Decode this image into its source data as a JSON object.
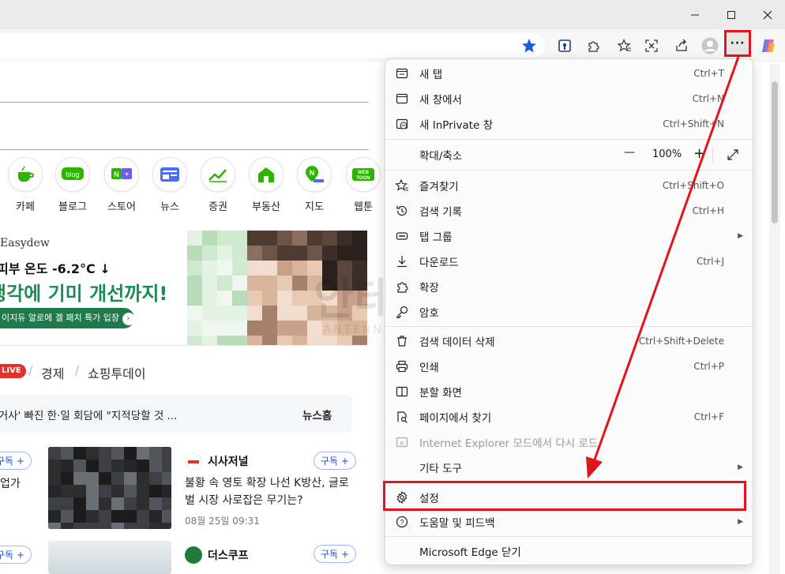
{
  "window": {
    "minimize": "—",
    "maximize": "☐",
    "close": "✕"
  },
  "shortcuts": [
    {
      "label": "카페",
      "icon": "cafe-icon",
      "color": "#2db400"
    },
    {
      "label": "블로그",
      "icon": "blog-icon",
      "color": "#2db400"
    },
    {
      "label": "스토어",
      "icon": "store-icon",
      "color": "#2db400"
    },
    {
      "label": "뉴스",
      "icon": "news-icon",
      "color": "#4a6cf7"
    },
    {
      "label": "증권",
      "icon": "stock-icon",
      "color": "#2db400"
    },
    {
      "label": "부동산",
      "icon": "realestate-icon",
      "color": "#2db400"
    },
    {
      "label": "지도",
      "icon": "map-icon",
      "color": "#2db400"
    },
    {
      "label": "웹툰",
      "icon": "webtoon-icon",
      "color": "#2db400"
    }
  ],
  "ad": {
    "brand": "Easydew",
    "line1": "피부 온도 -6.2°C ↓",
    "line2": "생각에 기미 개선까지!",
    "button": "이지듀 알로에 겔 패치 특가 입장"
  },
  "news_tabs": {
    "live": "LIVE",
    "tab1": "경제",
    "tab2": "쇼핑투데이"
  },
  "headline": {
    "text": "'거사' 빠진 한·일 회담에 \"지적당할 것 ...",
    "link": "뉴스홈"
  },
  "articles": [
    {
      "publisher": "시사저널",
      "subscribe": "구독",
      "title": "불황 속 영토 확장 나선 K방산, 글로벌 시장 사로잡은 무기는?",
      "date": "08월 25일 09:31",
      "left_subscribe": "구독",
      "left_text": "업가"
    },
    {
      "publisher": "더스쿠프",
      "subscribe": "구독",
      "title": "",
      "date": "",
      "left_subscribe": "구독",
      "left_text": ""
    }
  ],
  "menu": {
    "new_tab": {
      "label": "새 탭",
      "shortcut": "Ctrl+T"
    },
    "new_window": {
      "label": "새 창에서",
      "shortcut": "Ctrl+N"
    },
    "new_inprivate": {
      "label": "새 InPrivate 창",
      "shortcut": "Ctrl+Shift+N"
    },
    "zoom": {
      "label": "확대/축소",
      "value": "100%",
      "minus": "—",
      "plus": "+"
    },
    "favorites": {
      "label": "즐겨찾기",
      "shortcut": "Ctrl+Shift+O"
    },
    "history": {
      "label": "검색 기록",
      "shortcut": "Ctrl+H"
    },
    "tab_groups": {
      "label": "탭 그룹"
    },
    "downloads": {
      "label": "다운로드",
      "shortcut": "Ctrl+J"
    },
    "extensions": {
      "label": "확장"
    },
    "passwords": {
      "label": "암호"
    },
    "clear_data": {
      "label": "검색 데이터 삭제",
      "shortcut": "Ctrl+Shift+Delete"
    },
    "print": {
      "label": "인쇄",
      "shortcut": "Ctrl+P"
    },
    "split_screen": {
      "label": "분할 화면"
    },
    "find": {
      "label": "페이지에서 찾기",
      "shortcut": "Ctrl+F"
    },
    "ie_mode": {
      "label": "Internet Explorer 모드에서 다시 로드"
    },
    "more_tools": {
      "label": "기타 도구"
    },
    "settings": {
      "label": "설정"
    },
    "help": {
      "label": "도움말 및 피드백"
    },
    "close_edge": {
      "label": "Microsoft Edge 닫기"
    }
  },
  "watermark": {
    "text": "안테나곰",
    "sub": "ANTENNAGOM.COM"
  },
  "colors": {
    "highlight": "#e3141e",
    "accent": "#2db400",
    "star": "#1a5fd6"
  }
}
